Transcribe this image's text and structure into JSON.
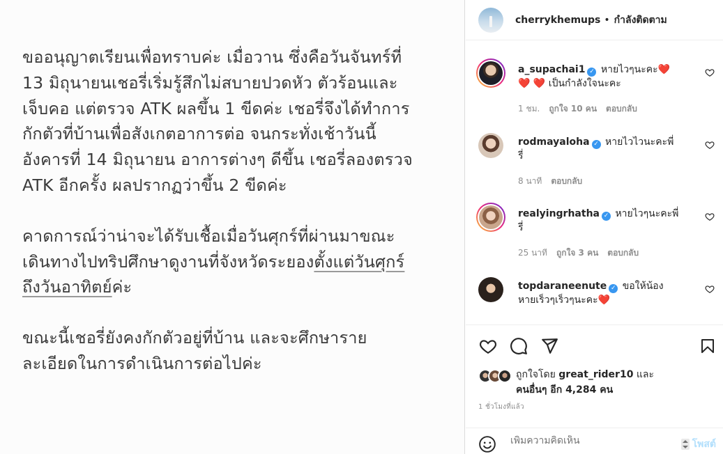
{
  "post": {
    "paragraphs": [
      "ขออนุญาตเรียนเพื่อทราบค่ะ เมื่อวาน ซึ่งคือวันจันทร์ที่\n13 มิถุนายนเชอรี่เริ่มรู้สึกไม่สบายปวดหัว ตัวร้อนและ\nเจ็บคอ แต่ตรวจ ATK ผลขึ้น 1 ขีดค่ะ  เชอรี่จึงได้ทำการ\nกักตัวที่บ้านเพื่อสังเกตอาการต่อ  จนกระทั่งเช้าวันนี้\nอังคารที่ 14 มิถุนายน อาการต่างๆ ดีขึ้น เชอรี่ลองตรวจ\nATK อีกครั้ง ผลปรากฏว่าขึ้น 2 ขีดค่ะ",
      "ขณะนี้เชอรี่ยังคงกักตัวอยู่ที่บ้าน และจะศึกษาราย\nละเอียดในการดำเนินการต่อไปค่ะ"
    ],
    "p2_start": "คาดการณ์ว่าน่าจะได้รับเชื้อเมื่อวันศุกร์ที่ผ่านมาขณะ\nเดินทางไปทริปศึกษาดูงานที่จังหวัดระยอง",
    "p2_underlined": "ตั้งแต่วันศุกร์\nถึงวันอาทิตย์",
    "p2_end": "ค่ะ"
  },
  "header": {
    "username": "cherrykhemups",
    "dot": "•",
    "follow_label": "กำลังติดตาม"
  },
  "comments": [
    {
      "username": "a_supachai1",
      "text_before": "หายไวๆนะคะ",
      "hearts_mid": "❤️",
      "line2_hearts": "❤️ ❤️",
      "text_after": "เป็นกำลังใจนะคะ",
      "time": "1 ชม.",
      "likes": "ถูกใจ 10 คน",
      "reply": "ตอบกลับ"
    },
    {
      "username": "rodmayaloha",
      "text": "หายไวไวนะคะพี่\nรี่",
      "time": "8 นาที",
      "reply": "ตอบกลับ"
    },
    {
      "username": "realyingrhatha",
      "text": "หายไวๆนะคะพี่\nรี่",
      "time": "25 นาที",
      "likes": "ถูกใจ 3 คน",
      "reply": "ตอบกลับ"
    },
    {
      "username": "topdaraneenute",
      "text_before": "ขอให้น้อง\nหายเร็วๆเร็วๆนะคะ",
      "heart": "❤️"
    }
  ],
  "likes": {
    "prefix": "ถูกใจโดย",
    "user": "great_rider10",
    "and": "และ",
    "others": "คนอื่นๆ อีก 4,284 คน"
  },
  "posted_time": "1 ชั่วโมงที่แล้ว",
  "add_comment": {
    "placeholder": "เพิ่มความคิดเห็น",
    "post_label": "โพสต์"
  },
  "colors": {
    "verified": "#3897f0",
    "heart": "#ed1c24",
    "post_button": "#b2dffc"
  }
}
